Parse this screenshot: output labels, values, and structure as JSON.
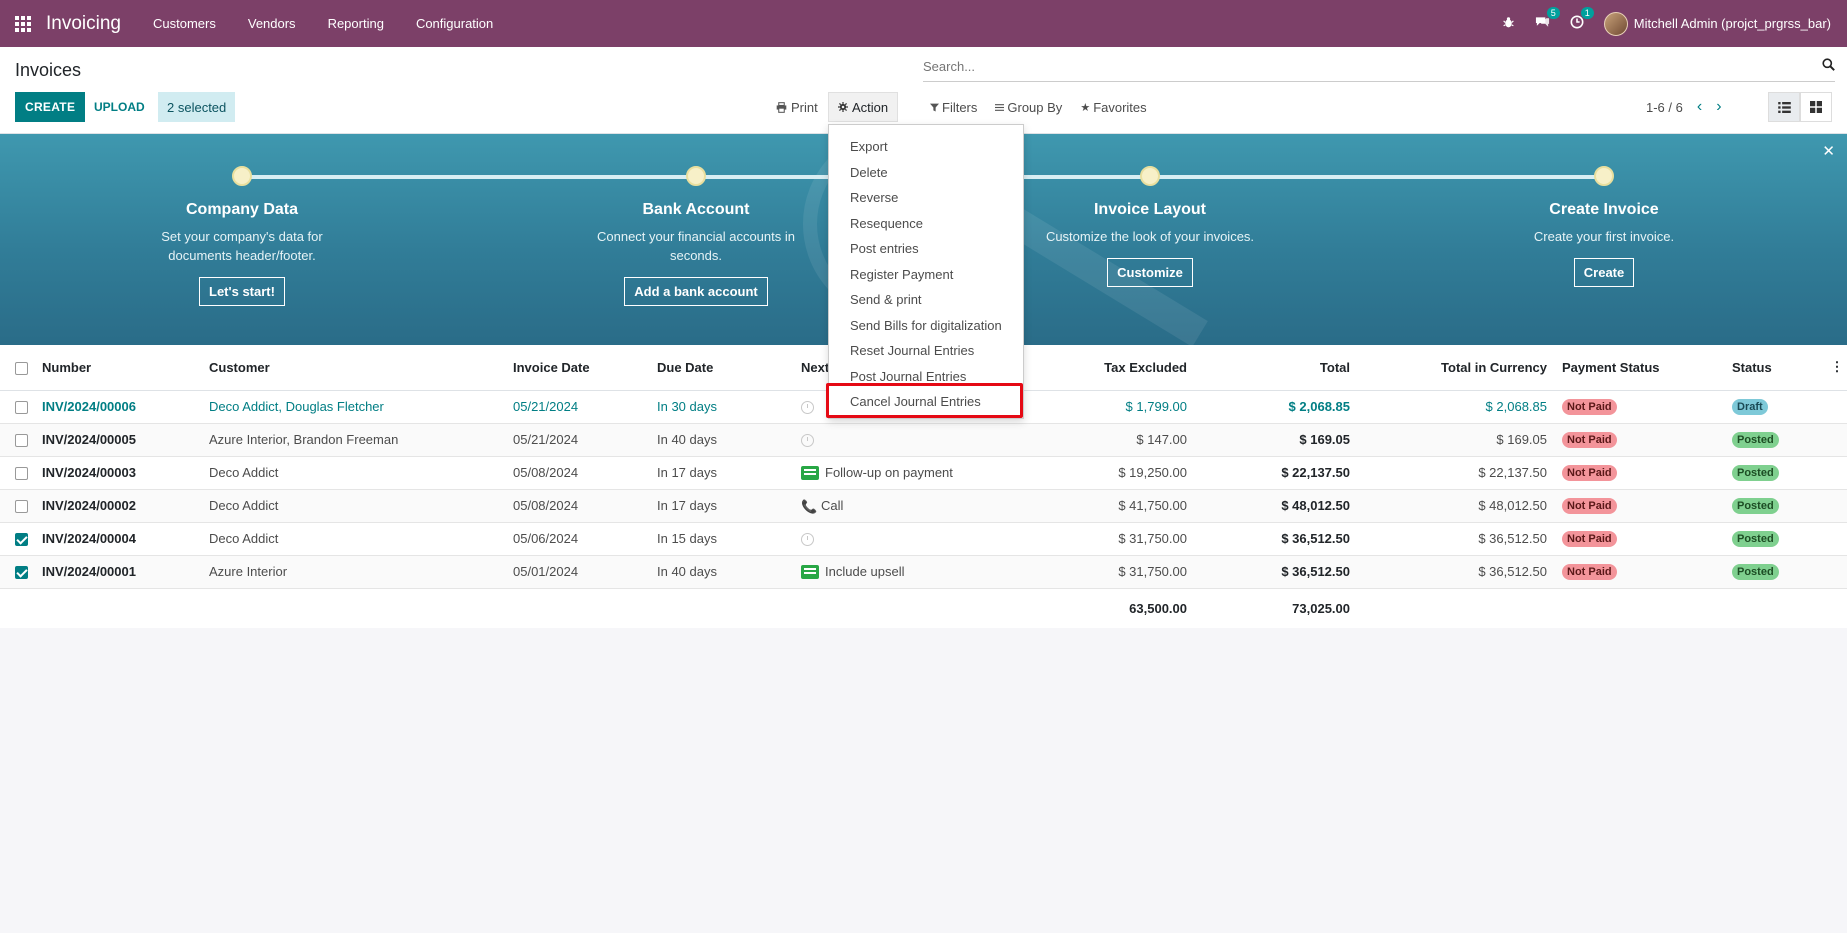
{
  "app": {
    "name": "Invoicing",
    "menu": [
      "Customers",
      "Vendors",
      "Reporting",
      "Configuration"
    ],
    "messages_count": "5",
    "activities_count": "1",
    "user": "Mitchell Admin (projct_prgrss_bar)"
  },
  "control_panel": {
    "title": "Invoices",
    "create_label": "CREATE",
    "upload_label": "UPLOAD",
    "selected_label": "2 selected",
    "print_label": "Print",
    "action_label": "Action",
    "search_placeholder": "Search...",
    "filters_label": "Filters",
    "groupby_label": "Group By",
    "favorites_label": "Favorites",
    "pager": "1-6 / 6"
  },
  "banner": {
    "steps": [
      {
        "title": "Company Data",
        "desc": "Set your company's data for documents header/footer.",
        "button": "Let's start!"
      },
      {
        "title": "Bank Account",
        "desc": "Connect your financial accounts in seconds.",
        "button": "Add a bank account"
      },
      {
        "title": "Invoice Layout",
        "desc": "Customize the look of your invoices.",
        "button": "Customize"
      },
      {
        "title": "Create Invoice",
        "desc": "Create your first invoice.",
        "button": "Create"
      }
    ]
  },
  "action_menu": {
    "items": [
      "Export",
      "Delete",
      "Reverse",
      "Resequence",
      "Post entries",
      "Register Payment",
      "Send & print",
      "Send Bills for digitalization",
      "Reset Journal Entries",
      "Post Journal Entries",
      "Cancel Journal Entries"
    ],
    "highlighted": "Cancel Journal Entries"
  },
  "table": {
    "columns": [
      "Number",
      "Customer",
      "Invoice Date",
      "Due Date",
      "Next",
      "Tax Excluded",
      "Total",
      "Total in Currency",
      "Payment Status",
      "Status"
    ],
    "rows": [
      {
        "number": "INV/2024/00006",
        "customer": "Deco Addict, Douglas Fletcher",
        "invoice_date": "05/21/2024",
        "due_date": "In 30 days",
        "activity": "",
        "activity_icon": "clock-icon",
        "tax_excluded": "$ 1,799.00",
        "total": "$ 2,068.85",
        "total_currency": "$ 2,068.85",
        "payment_status": "Not Paid",
        "status": "Draft",
        "checked": false
      },
      {
        "number": "INV/2024/00005",
        "customer": "Azure Interior, Brandon Freeman",
        "invoice_date": "05/21/2024",
        "due_date": "In 40 days",
        "activity": "",
        "activity_icon": "clock-icon",
        "tax_excluded": "$ 147.00",
        "total": "$ 169.05",
        "total_currency": "$ 169.05",
        "payment_status": "Not Paid",
        "status": "Posted",
        "checked": false
      },
      {
        "number": "INV/2024/00003",
        "customer": "Deco Addict",
        "invoice_date": "05/08/2024",
        "due_date": "In 17 days",
        "activity": "Follow-up on payment",
        "activity_icon": "todo-icon",
        "tax_excluded": "$ 19,250.00",
        "total": "$ 22,137.50",
        "total_currency": "$ 22,137.50",
        "payment_status": "Not Paid",
        "status": "Posted",
        "checked": false
      },
      {
        "number": "INV/2024/00002",
        "customer": "Deco Addict",
        "invoice_date": "05/08/2024",
        "due_date": "In 17 days",
        "activity": "Call",
        "activity_icon": "phone-icon",
        "tax_excluded": "$ 41,750.00",
        "total": "$ 48,012.50",
        "total_currency": "$ 48,012.50",
        "payment_status": "Not Paid",
        "status": "Posted",
        "checked": false
      },
      {
        "number": "INV/2024/00004",
        "customer": "Deco Addict",
        "invoice_date": "05/06/2024",
        "due_date": "In 15 days",
        "activity": "",
        "activity_icon": "clock-icon",
        "tax_excluded": "$ 31,750.00",
        "total": "$ 36,512.50",
        "total_currency": "$ 36,512.50",
        "payment_status": "Not Paid",
        "status": "Posted",
        "checked": true
      },
      {
        "number": "INV/2024/00001",
        "customer": "Azure Interior",
        "invoice_date": "05/01/2024",
        "due_date": "In 40 days",
        "activity": "Include upsell",
        "activity_icon": "todo-icon",
        "tax_excluded": "$ 31,750.00",
        "total": "$ 36,512.50",
        "total_currency": "$ 36,512.50",
        "payment_status": "Not Paid",
        "status": "Posted",
        "checked": true
      }
    ],
    "totals": {
      "tax_excluded": "63,500.00",
      "total": "73,025.00"
    }
  },
  "colors": {
    "brand": "#7c4068",
    "primary": "#017e84",
    "banner": "#3a8ca7",
    "highlight": "#e50914"
  }
}
